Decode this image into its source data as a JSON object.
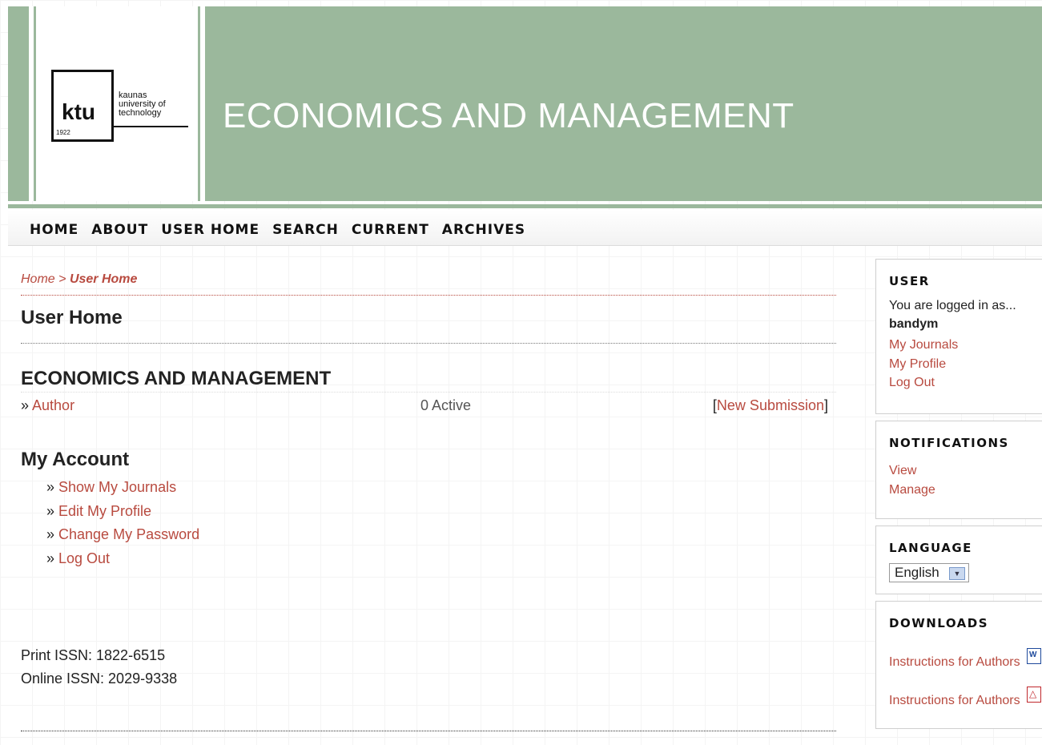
{
  "header": {
    "logo": {
      "brand": "ktu",
      "line1": "kaunas",
      "line2": "university of",
      "line3": "technology",
      "year": "1922"
    },
    "title": "ECONOMICS AND MANAGEMENT"
  },
  "nav": {
    "items": [
      "HOME",
      "ABOUT",
      "USER HOME",
      "SEARCH",
      "CURRENT",
      "ARCHIVES"
    ]
  },
  "breadcrumb": {
    "home": "Home",
    "separator": ">",
    "current": "User Home"
  },
  "page_title": "User Home",
  "journal": {
    "title": "ECONOMICS AND MANAGEMENT",
    "role_prefix": "»",
    "role": "Author",
    "active": "0 Active",
    "new_submission": "New Submission"
  },
  "my_account": {
    "title": "My Account",
    "items": [
      "Show My Journals",
      "Edit My Profile",
      "Change My Password",
      "Log Out"
    ]
  },
  "issn": {
    "print": "Print ISSN: 1822-6515",
    "online": "Online ISSN: 2029-9338"
  },
  "sidebar": {
    "user": {
      "title": "USER",
      "logged_in_as": "You are logged in as...",
      "username": "bandym",
      "links": [
        "My Journals",
        "My Profile",
        "Log Out"
      ]
    },
    "notifications": {
      "title": "NOTIFICATIONS",
      "links": [
        "View",
        "Manage"
      ]
    },
    "language": {
      "title": "LANGUAGE",
      "selected": "English"
    },
    "downloads": {
      "title": "DOWNLOADS",
      "items": [
        {
          "label": "Instructions for Authors",
          "icon": "word-doc-icon"
        },
        {
          "label": "Instructions for Authors",
          "icon": "pdf-doc-icon"
        }
      ]
    }
  }
}
